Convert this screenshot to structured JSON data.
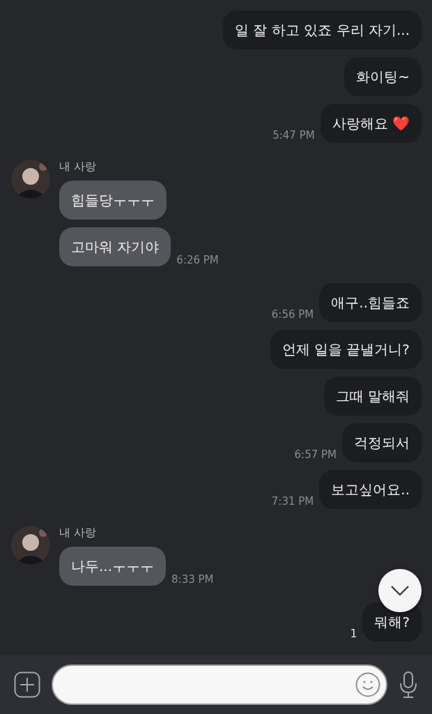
{
  "groups": [
    {
      "kind": "sent",
      "messages": [
        {
          "text": "일 잘 하고 있죠 우리 자기..."
        },
        {
          "text": "화이팅~"
        },
        {
          "text": "사랑해요 ❤️",
          "time": "5:47 PM"
        }
      ]
    },
    {
      "kind": "received",
      "sender": "내 사랑",
      "messages": [
        {
          "text": "힘들당ㅜㅜㅜ"
        },
        {
          "text": "고마워 자기야",
          "time": "6:26 PM"
        }
      ]
    },
    {
      "kind": "sent",
      "messages": [
        {
          "text": "애구..힘들죠",
          "time": "6:56 PM"
        },
        {
          "text": "언제 일을 끝낼거니?"
        },
        {
          "text": "그때 말해줘"
        },
        {
          "text": "걱정되서",
          "time": "6:57 PM"
        },
        {
          "text": "보고싶어요..",
          "time": "7:31 PM"
        }
      ]
    },
    {
      "kind": "received",
      "sender": "내 사랑",
      "messages": [
        {
          "text": "나두...ㅜㅜㅜ",
          "time": "8:33 PM"
        }
      ]
    },
    {
      "kind": "sent",
      "messages": [
        {
          "text": "뭐해?",
          "unread": "1"
        }
      ]
    }
  ]
}
